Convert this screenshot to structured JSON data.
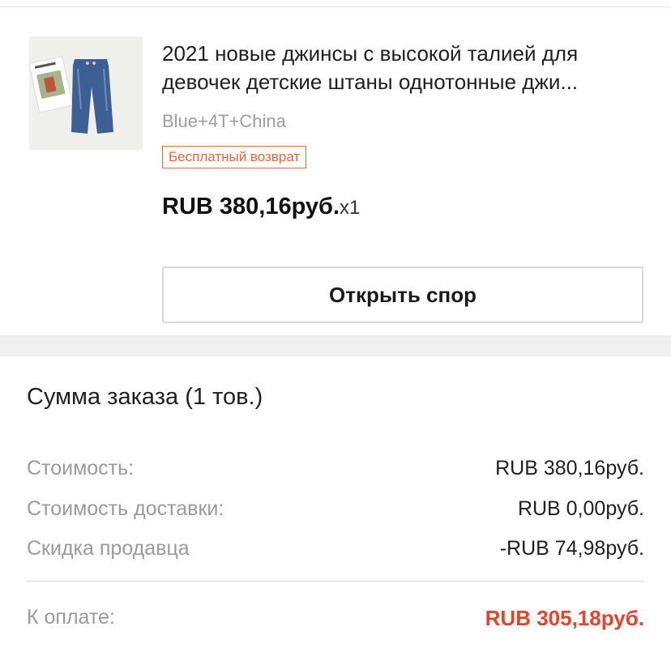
{
  "product": {
    "title": "2021 новые джинсы с высокой талией для девочек детские штаны однотонные джи...",
    "variant": "Blue+4T+China",
    "badge": "Бесплатный возврат",
    "price": "RUB 380,16руб.",
    "quantity": "x1",
    "thumbnail_label": "product-thumbnail",
    "dispute_button": "Открыть спор"
  },
  "summary": {
    "title": "Сумма заказа (1 тов.)",
    "rows": [
      {
        "label": "Стоимость:",
        "value": "RUB 380,16руб."
      },
      {
        "label": "Стоимость доставки:",
        "value": "RUB 0,00руб."
      },
      {
        "label": "Скидка продавца",
        "value": "-RUB 74,98руб."
      }
    ],
    "total_label": "К оплате:",
    "total_value": "RUB 305,18руб."
  },
  "colors": {
    "accent": "#e8412c",
    "badge": "#e3683a",
    "muted": "#9a9a9a"
  }
}
